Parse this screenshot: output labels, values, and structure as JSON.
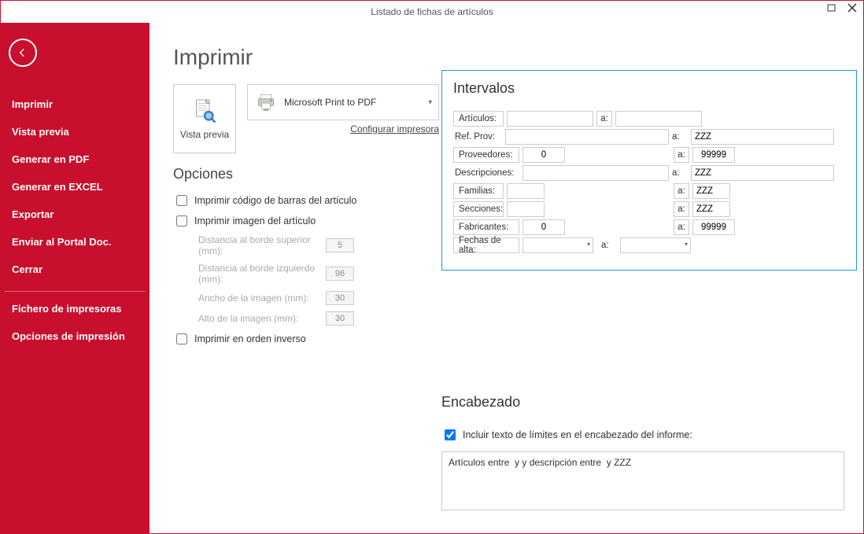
{
  "window": {
    "title": "Listado de fichas de artículos"
  },
  "sidebar": {
    "items": [
      "Imprimir",
      "Vista previa",
      "Generar en PDF",
      "Generar en EXCEL",
      "Exportar",
      "Enviar al Portal Doc.",
      "Cerrar"
    ],
    "secondary": [
      "Fichero de impresoras",
      "Opciones de impresión"
    ]
  },
  "page": {
    "title": "Imprimir",
    "preview_label": "Vista previa",
    "printer_name": "Microsoft Print to PDF",
    "config_printer": "Configurar impresora"
  },
  "options": {
    "title": "Opciones",
    "print_barcode": "Imprimir código de barras del artículo",
    "print_image": "Imprimir imagen del artículo",
    "dist_top_label": "Distancia al borde superior (mm):",
    "dist_top_value": "5",
    "dist_left_label": "Distancia al borde izquierdo (mm):",
    "dist_left_value": "96",
    "width_label": "Ancho de la imagen (mm):",
    "width_value": "30",
    "height_label": "Alto de la imagen (mm):",
    "height_value": "30",
    "reverse_order": "Imprimir en orden inverso"
  },
  "intervals": {
    "title": "Intervalos",
    "to_label": "a:",
    "articulos": {
      "label": "Artículos:",
      "from": "",
      "to": ""
    },
    "ref_prov": {
      "label": "Ref. Prov:",
      "from": "",
      "to": "ZZZ"
    },
    "proveedores": {
      "label": "Proveedores:",
      "from": "0",
      "to": "99999"
    },
    "descripciones": {
      "label": "Descripciones:",
      "from": "",
      "to": "ZZZ"
    },
    "familias": {
      "label": "Familias:",
      "from": "",
      "to": "ZZZ"
    },
    "secciones": {
      "label": "Secciones:",
      "from": "",
      "to": "ZZZ"
    },
    "fabricantes": {
      "label": "Fabricantes:",
      "from": "0",
      "to": "99999"
    },
    "fechas": {
      "label": "Fechas de alta:",
      "from": "",
      "to": ""
    }
  },
  "header": {
    "title": "Encabezado",
    "include_limits": "Incluir texto de límites en el encabezado del informe:",
    "text": "Artículos entre  y y descripción entre  y ZZZ"
  }
}
